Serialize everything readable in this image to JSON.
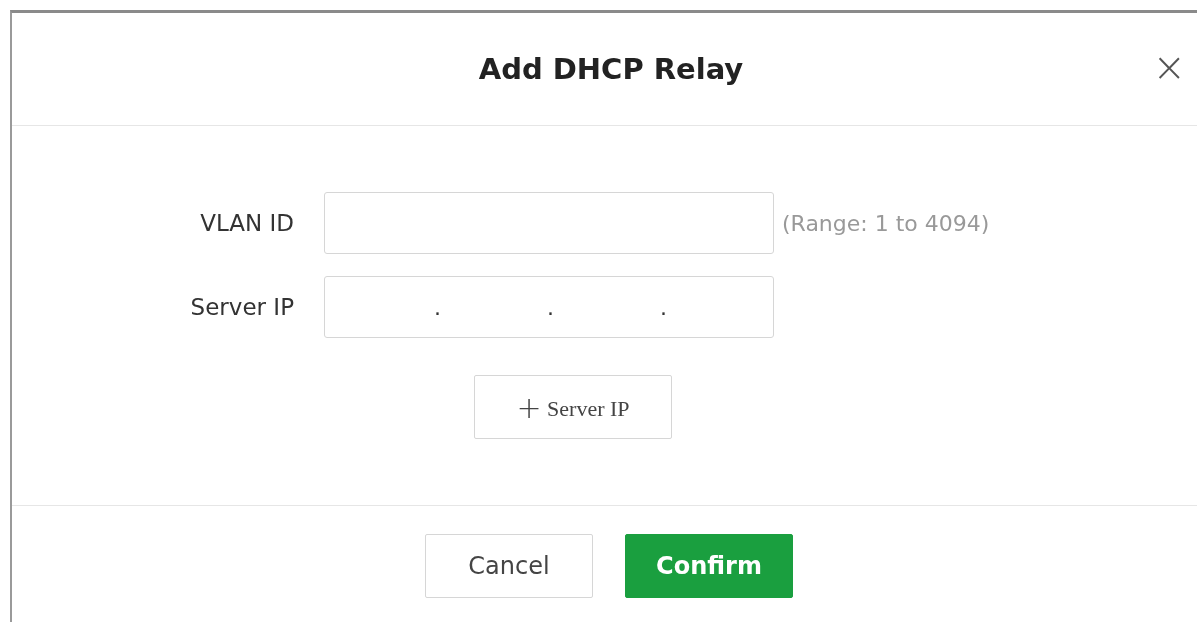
{
  "dialog": {
    "title": "Add DHCP Relay",
    "close": "×"
  },
  "fields": [
    {
      "kind": "text",
      "label": "VLAN ID",
      "hint": "(Range: 1 to 4094)"
    },
    {
      "kind": "ip",
      "label": "Server IP",
      "separators": [
        ".",
        ".",
        "."
      ]
    }
  ],
  "add_button": {
    "icon": "+",
    "label": "Server IP"
  },
  "buttons": [
    {
      "label": "Cancel",
      "kind": "secondary"
    },
    {
      "label": "Confirm",
      "kind": "primary"
    }
  ]
}
